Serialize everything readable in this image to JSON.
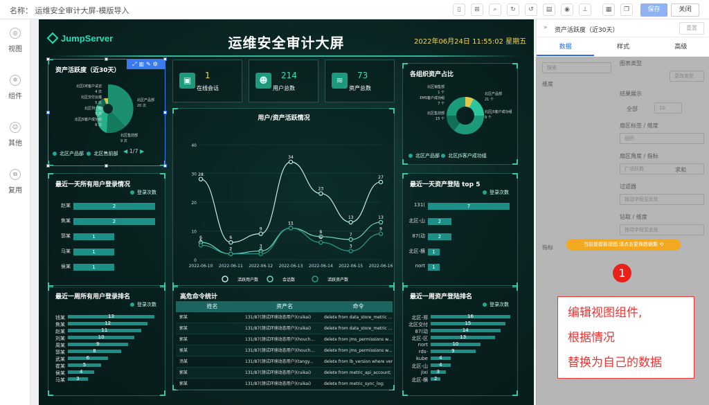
{
  "topbar": {
    "name": "名称： 运维安全审计大屏-模版导入",
    "save": "保存",
    "close": "关闭",
    "icons": [
      "phone-icon",
      "grid-icon",
      "search-icon",
      "refresh-icon",
      "undo-icon",
      "file-icon",
      "eye-icon",
      "stamp-icon",
      "qrcode-icon",
      "copy-icon"
    ]
  },
  "nav": [
    {
      "label": "视图",
      "icon": "view-icon"
    },
    {
      "label": "组件",
      "icon": "component-icon"
    },
    {
      "label": "其他",
      "icon": "other-icon"
    },
    {
      "label": "复用",
      "icon": "reuse-icon"
    }
  ],
  "screen": {
    "logo": "JumpServer",
    "title": "运维安全审计大屏",
    "datetime": "2022年06月24日 11:55:02 星期五"
  },
  "stats": [
    {
      "value": "1",
      "label": "在线会话"
    },
    {
      "value": "214",
      "label": "用户总数"
    },
    {
      "value": "73",
      "label": "资产总数"
    }
  ],
  "panels": {
    "active": {
      "title": "资产活跃度（近30天）",
      "labels": [
        "北区DE客户试访",
        "4 次",
        "北区交付云端",
        "5 次",
        "北区列一组",
        "5 次",
        "北区JS客户成功组",
        "6 次",
        "北区产品部",
        "20 次",
        "北区售前部",
        "9 次"
      ],
      "legend": [
        "北区产品部",
        "北区售前部"
      ],
      "pager": "1/7"
    },
    "org": {
      "title": "各组织资产占比",
      "labels": [
        "北区销售部",
        "1 个",
        "EMS客户成功组",
        "7 个",
        "北区产品部",
        "21 个",
        "北区售前部",
        "15 个",
        "北区JS客户成功组",
        "9 个"
      ],
      "legend": [
        "北区产品部",
        "北区JS客户成功组"
      ]
    },
    "dayUserLogin": {
      "title": "最近一天所有用户登录情况",
      "legend": "登录次数"
    },
    "dayAssetLogin": {
      "title": "最近一天资产登陆 top 5",
      "legend": "登录次数"
    },
    "weekUserRank": {
      "title": "最近一周所有用户登录排名",
      "legend": "登录次数"
    },
    "weekAssetRank": {
      "title": "最近一周资产登陆排名",
      "legend": "登录次数"
    },
    "commands": {
      "title": "高危命令统计",
      "headers": [
        "姓名",
        "资产名",
        "命令"
      ],
      "rows": [
        [
          "郭某",
          "131/87(测试环境动态用户)(ruikai)",
          "delete from data_store_metric ..."
        ],
        [
          "郭某",
          "131/87(测试环境动态用户)(ruikai)",
          "delete from data_store_metric ..."
        ],
        [
          "郭某",
          "131/87(测试环境动态用户)(houch...",
          "delete from jms_permissions w..."
        ],
        [
          "侯某",
          "131/87(测试环境动态用户)(houch...",
          "delete from jms_permissions w..."
        ],
        [
          "汤某",
          "131/87(测试环境动态用户)(tangy...",
          "delete from lb_version where ver..."
        ],
        [
          "郭某",
          "131/87(测试环境动态用户)(ruikai)",
          "delete from metric_api_account;"
        ],
        [
          "郭某",
          "131/87(测试环境动态用户)(ruikai)",
          "delete from metric_sync_log;"
        ]
      ]
    }
  },
  "chart_data": [
    {
      "type": "line",
      "title": "用户/资产活跃情况",
      "categories": [
        "2022-06-10",
        "2022-06-11",
        "2022-06-12",
        "2022-06-13",
        "2022-06-14",
        "2022-06-15",
        "2022-06-16"
      ],
      "ylim": [
        0,
        40
      ],
      "series": [
        {
          "name": "活跃用户数",
          "values": [
            28,
            6,
            9,
            34,
            23,
            13,
            27
          ]
        },
        {
          "name": "会话数",
          "values": [
            6,
            2,
            3,
            11,
            8,
            7,
            13
          ]
        },
        {
          "name": "活跃资产数",
          "values": [
            5,
            2,
            2,
            11,
            6,
            3,
            9
          ]
        }
      ]
    },
    {
      "type": "bar",
      "title": "最近一天所有用户登录情况",
      "categories": [
        "赵某",
        "焦某",
        "郭某",
        "马某",
        "侯某"
      ],
      "values": [
        2,
        2,
        1,
        1,
        1
      ]
    },
    {
      "type": "bar",
      "title": "最近一天资产登陆 top 5",
      "categories": [
        "131(",
        "北区-山",
        "87(动",
        "北区-横",
        "nort"
      ],
      "values": [
        7,
        2,
        2,
        1,
        1
      ]
    },
    {
      "type": "bar",
      "title": "最近一周所有用户登录排名",
      "categories": [
        "钱某",
        "焦某",
        "赵某",
        "刘某",
        "周某",
        "郭某",
        "武某",
        "崔某",
        "侯某",
        "马某"
      ],
      "values": [
        13,
        12,
        11,
        10,
        9,
        8,
        6,
        5,
        4,
        3
      ]
    },
    {
      "type": "bar",
      "title": "最近一周资产登陆排名",
      "categories": [
        "北区-郑",
        "北区交付",
        "87(动",
        "北区-区",
        "nort",
        "rds-",
        "kube",
        "北区-山",
        "jixi",
        "北区-横"
      ],
      "values": [
        16,
        15,
        14,
        13,
        10,
        9,
        4,
        4,
        3,
        2
      ]
    }
  ],
  "right": {
    "title": "资产活跃度（近30天）",
    "reset": "重置",
    "tabs": [
      "数据",
      "样式",
      "高级"
    ],
    "search": "搜索",
    "dim": "维度",
    "chartType": "图表类型",
    "changeType": "更改类型",
    "result": "结果展示",
    "all": "全部",
    "count": "10",
    "sectorLabel": "扇区标签 / 维度",
    "sectorField": "组织",
    "sectorAngle": "扇区角度 / 指标",
    "angleField": "广活跃数",
    "agg": "求和",
    "filter": "过滤器",
    "filterPh": "拖动字段至此处",
    "drill": "钻取 / 维度",
    "drillPh": "拖动字段至此处",
    "metric": "指标"
  },
  "overlay": {
    "button": "当前是模板视图,请点击更换数据集",
    "badge": "1",
    "note": [
      "编辑视图组件,",
      "根据情况",
      "替换为自己的数据"
    ]
  }
}
